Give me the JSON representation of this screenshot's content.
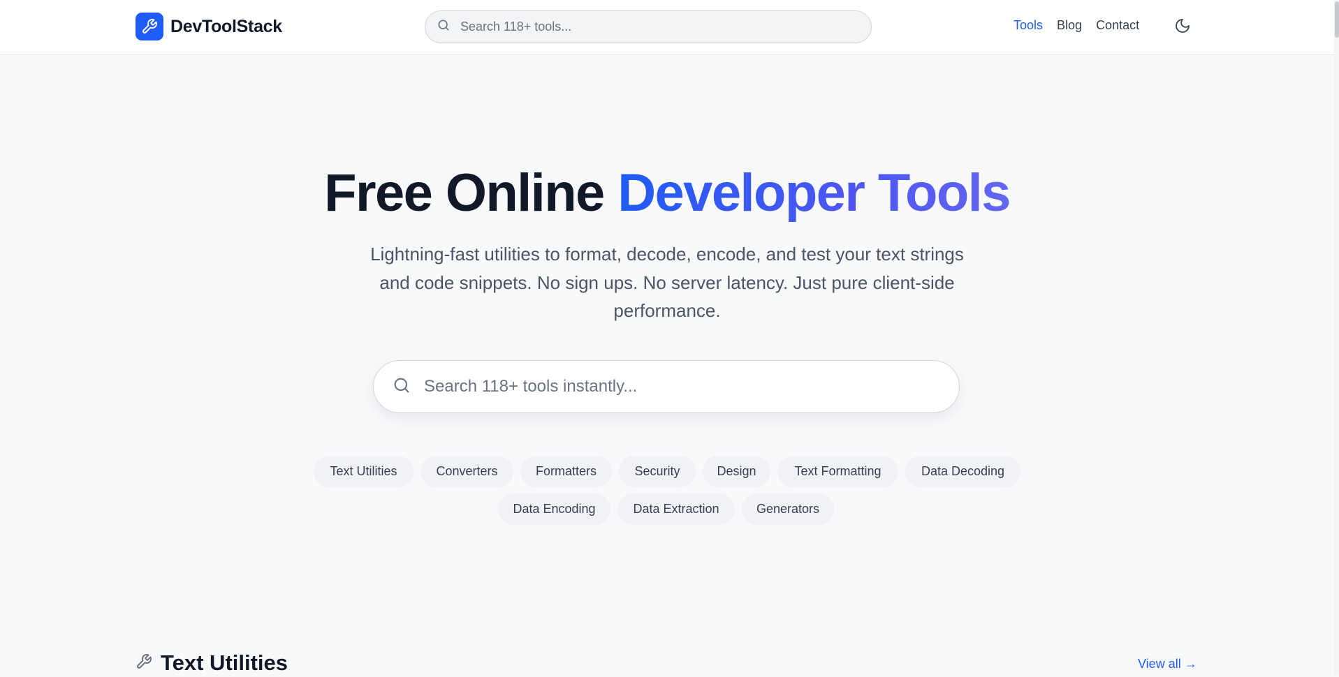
{
  "brand": {
    "name": "DevToolStack",
    "logo_icon": "wrench-icon",
    "color": "#1f5cf5"
  },
  "header": {
    "search_placeholder": "Search 118+ tools...",
    "nav": [
      {
        "label": "Tools",
        "active": true
      },
      {
        "label": "Blog",
        "active": false
      },
      {
        "label": "Contact",
        "active": false
      }
    ],
    "theme_icon": "moon-icon"
  },
  "hero": {
    "title_plain": "Free Online",
    "title_accent": "Developer Tools",
    "subtitle": "Lightning-fast utilities to format, decode, encode, and test your text strings and code snippets. No sign ups. No server latency. Just pure client-side performance.",
    "search_placeholder": "Search 118+ tools instantly..."
  },
  "categories": [
    "Text Utilities",
    "Converters",
    "Formatters",
    "Security",
    "Design",
    "Text Formatting",
    "Data Decoding",
    "Data Encoding",
    "Data Extraction",
    "Generators"
  ],
  "section": {
    "title": "Text Utilities",
    "icon": "wrench-icon",
    "view_all": "View all →"
  },
  "colors": {
    "accent": "#1f5cf5",
    "accent_gradient_end": "#6366f1",
    "background": "#f8f9fb",
    "text_primary": "#111827",
    "text_muted": "#4b5563"
  }
}
